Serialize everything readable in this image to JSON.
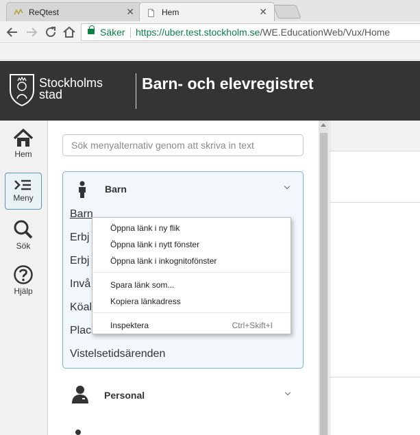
{
  "browser": {
    "tabs": [
      {
        "title": "ReQtest",
        "close": "✕",
        "active": false
      },
      {
        "title": "Hem",
        "close": "✕",
        "active": true
      }
    ],
    "address": {
      "secure_label": "Säker",
      "url_host": "https://uber.test.stockholm.se",
      "url_path": "/WE.EducationWeb/Vux/Home"
    },
    "nav_icons": [
      "back-arrow-icon",
      "forward-arrow-icon",
      "reload-icon",
      "home-icon"
    ]
  },
  "header": {
    "logo_line1": "Stockholms",
    "logo_line2": "stad",
    "title": "Barn- och elevregistret"
  },
  "sidebar": {
    "items": [
      {
        "label": "Hem",
        "icon": "home-icon"
      },
      {
        "label": "Meny",
        "icon": "menu-icon",
        "selected": true
      },
      {
        "label": "Sök",
        "icon": "search-icon"
      },
      {
        "label": "Hjälp",
        "icon": "help-icon"
      }
    ]
  },
  "menu": {
    "search_placeholder": "Sök menyalternativ genom att skriva in text",
    "groups": [
      {
        "title": "Barn",
        "expanded": true,
        "links": [
          "Barn",
          "Erbj",
          "Erbj",
          "Invå",
          "Köal",
          "Plac",
          "Vistelsetidsärenden"
        ]
      },
      {
        "title": "Personal",
        "expanded": false
      }
    ]
  },
  "context_menu": {
    "items": [
      {
        "label": "Öppna länk i ny flik"
      },
      {
        "label": "Öppna länk i nytt fönster"
      },
      {
        "label": "Öppna länk i inkognitofönster"
      },
      {
        "label": "Spara länk som..."
      },
      {
        "label": "Kopiera länkadress"
      },
      {
        "label": "Inspektera",
        "shortcut": "Ctrl+Skift+I"
      }
    ]
  },
  "colors": {
    "header_bg": "#343434",
    "secure_green": "#0b8043",
    "selected_border": "#5a96b0",
    "group_bg": "#f1f7fa"
  }
}
